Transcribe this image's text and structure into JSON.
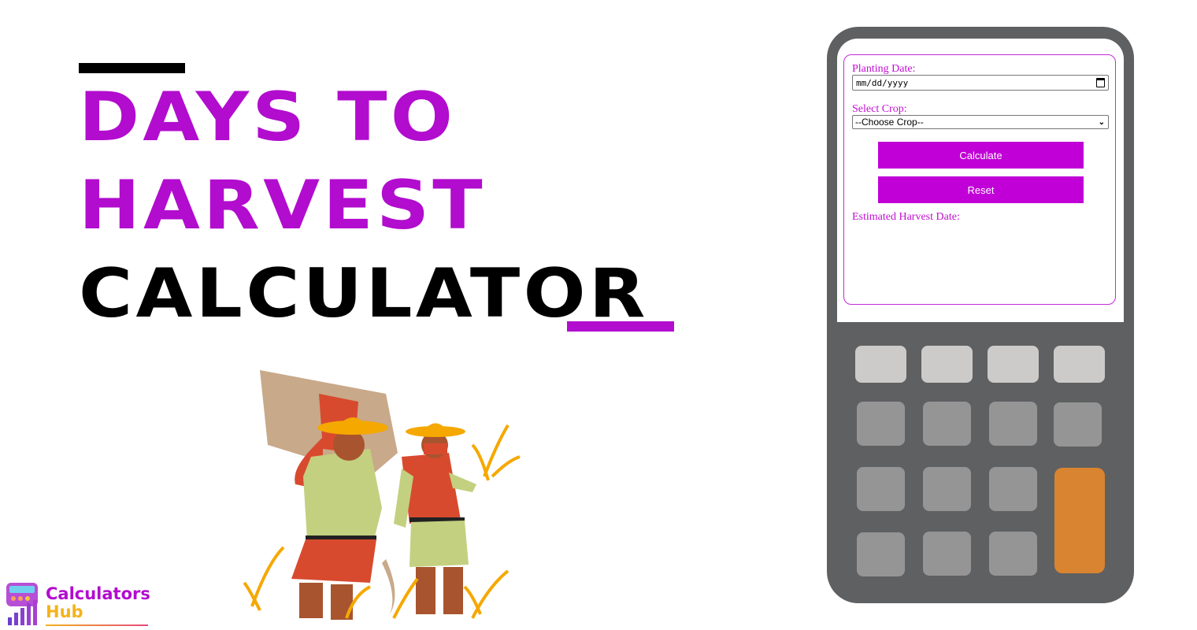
{
  "hero": {
    "title_line1": "DAYS TO",
    "title_line2": "HARVEST",
    "title_line3": "CALCULATOR"
  },
  "colors": {
    "accent": "#b20ccf",
    "button": "#c000d6",
    "calculator_body": "#5f6062",
    "key_light": "#cccbc9",
    "key_mid": "#959595",
    "key_orange": "#d98430"
  },
  "logo": {
    "line1": "Calculators",
    "line2": "Hub",
    "icon": "calculator-chart-icon"
  },
  "illustration": {
    "description": "Two farmers harvesting crops with sickles"
  },
  "form": {
    "planting_date_label": "Planting Date:",
    "planting_date_placeholder": "mm/dd/yyyy",
    "planting_date_value": "",
    "crop_label": "Select Crop:",
    "crop_selected": "--Choose Crop--",
    "calculate_label": "Calculate",
    "reset_label": "Reset",
    "result_label": "Estimated Harvest Date:",
    "result_value": ""
  }
}
